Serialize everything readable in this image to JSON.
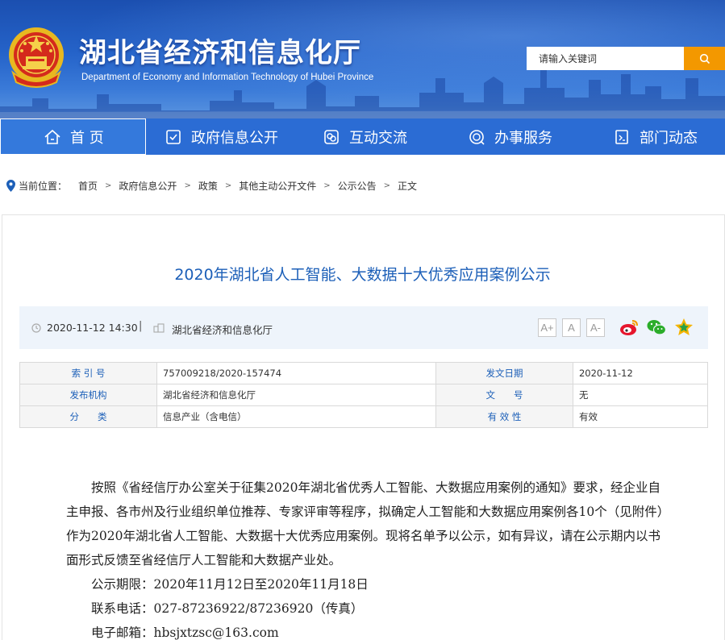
{
  "header": {
    "title": "湖北省经济和信息化厅",
    "subtitle": "Department of Economy and Information Technology of Hubei Province",
    "search_placeholder": "请输入关键词",
    "emblem_icon": "national-emblem-icon",
    "search_icon": "search-icon"
  },
  "nav": {
    "items": [
      {
        "label": "首 页",
        "icon": "home-icon"
      },
      {
        "label": "政府信息公开",
        "icon": "document-check-icon"
      },
      {
        "label": "互动交流",
        "icon": "chat-icon"
      },
      {
        "label": "办事服务",
        "icon": "service-icon"
      },
      {
        "label": "部门动态",
        "icon": "news-icon"
      }
    ],
    "active_color": "#3479dc"
  },
  "breadcrumb": {
    "prefix": "当前位置：",
    "items": [
      "首页",
      "政府信息公开",
      "政策",
      "其他主动公开文件",
      "公示公告",
      "正文"
    ]
  },
  "article": {
    "title": "2020年湖北省人工智能、大数据十大优秀应用案例公示",
    "datetime": "2020-11-12 14:30",
    "separator": "|",
    "source": "湖北省经济和信息化厅",
    "font_buttons": [
      "A+",
      "A",
      "A-"
    ],
    "share_icons": [
      "weibo-icon",
      "wechat-icon",
      "favorite-star-icon"
    ]
  },
  "info": {
    "rows": [
      {
        "k1": "索 引 号",
        "v1": "757009218/2020-157474",
        "k2": "发文日期",
        "v2": "2020-11-12"
      },
      {
        "k1": "发布机构",
        "v1": "湖北省经济和信息化厅",
        "k2": "文　　号",
        "v2": "无"
      },
      {
        "k1": "分　　类",
        "v1": "信息产业（含电信）",
        "k2": "有 效 性",
        "v2": "有效"
      }
    ]
  },
  "body": {
    "paragraph": "按照《省经信厅办公室关于征集2020年湖北省优秀人工智能、大数据应用案例的通知》要求，经企业自主申报、各市州及行业组织单位推荐、专家评审等程序，拟确定人工智能和大数据应用案例各10个（见附件）作为2020年湖北省人工智能、大数据十大优秀应用案例。现将名单予以公示，如有异议，请在公示期内以书面形式反馈至省经信厅人工智能和大数据产业处。",
    "period": "公示期限：2020年11月12日至2020年11月18日",
    "phone": "联系电话：027-87236922/87236920（传真）",
    "email": "电子邮箱：hbsjxtzsc@163.com"
  },
  "colors": {
    "header_blue": "#2563c9",
    "nav_blue": "#2b6cd4",
    "search_orange": "#f39800",
    "title_blue": "#1c5fb8",
    "meta_bg": "#eef4fb"
  }
}
